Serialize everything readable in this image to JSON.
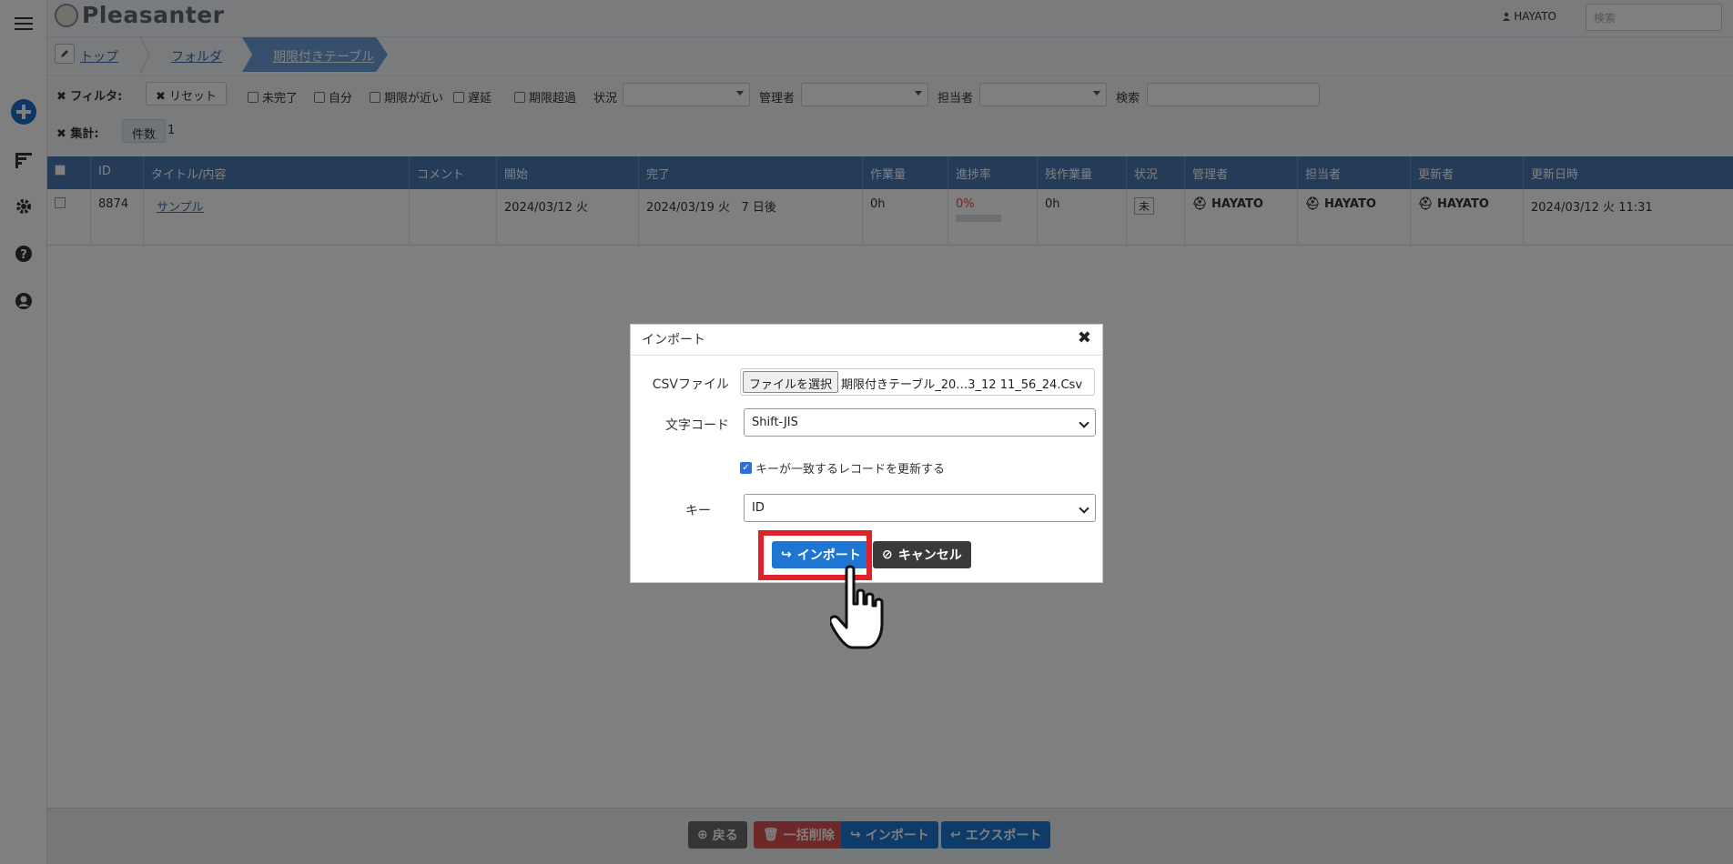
{
  "app": {
    "name": "Pleasanter",
    "user": "HAYATO",
    "search_placeholder": "検索"
  },
  "breadcrumb": [
    {
      "label": "トップ"
    },
    {
      "label": "フォルダ"
    },
    {
      "label": "期限付きテーブル"
    }
  ],
  "filters": {
    "filter_label": "フィルタ:",
    "reset_label": "リセット",
    "checkboxes": [
      "未完了",
      "自分",
      "期限が近い",
      "遅延",
      "期限超過"
    ],
    "status_label": "状況",
    "manager_label": "管理者",
    "owner_label": "担当者",
    "search_label": "検索",
    "aggregate_label": "集計:",
    "count_badge": "件数",
    "count_value": "1"
  },
  "grid": {
    "columns": [
      "ID",
      "タイトル/内容",
      "コメント",
      "開始",
      "完了",
      "作業量",
      "進捗率",
      "残作業量",
      "状況",
      "管理者",
      "担当者",
      "更新者",
      "更新日時"
    ],
    "rows": [
      {
        "id": "8874",
        "title": "サンプル",
        "comment": "",
        "start": "2024/03/12 火",
        "complete": "2024/03/19 火",
        "remaining_days": "7 日後",
        "work": "0h",
        "progress": "0%",
        "progress_fraction": 0.0,
        "remaining_work": "0h",
        "status": "未",
        "manager": "HAYATO",
        "owner": "HAYATO",
        "updater": "HAYATO",
        "updated": "2024/03/12 火 11:31"
      }
    ]
  },
  "footer": {
    "back": "戻る",
    "bulk_delete": "一括削除",
    "import": "インポート",
    "export": "エクスポート"
  },
  "dialog": {
    "title": "インポート",
    "csv_label": "CSVファイル",
    "file_button": "ファイルを選択",
    "file_name": "期限付きテーブル_20…3_12 11_56_24.Csv",
    "encoding_label": "文字コード",
    "encoding_value": "Shift-JIS",
    "update_check_label": "キーが一致するレコードを更新する",
    "update_checked": true,
    "key_label": "キー",
    "key_value": "ID",
    "import_button": "インポート",
    "cancel_button": "キャンセル"
  },
  "colors": {
    "header_blue": "#4b78b0",
    "import_blue": "#1f76d2",
    "cancel_dark": "#3a3a3a",
    "highlight_red": "#e0202a",
    "add_icon_blue": "#1f6fcc"
  }
}
